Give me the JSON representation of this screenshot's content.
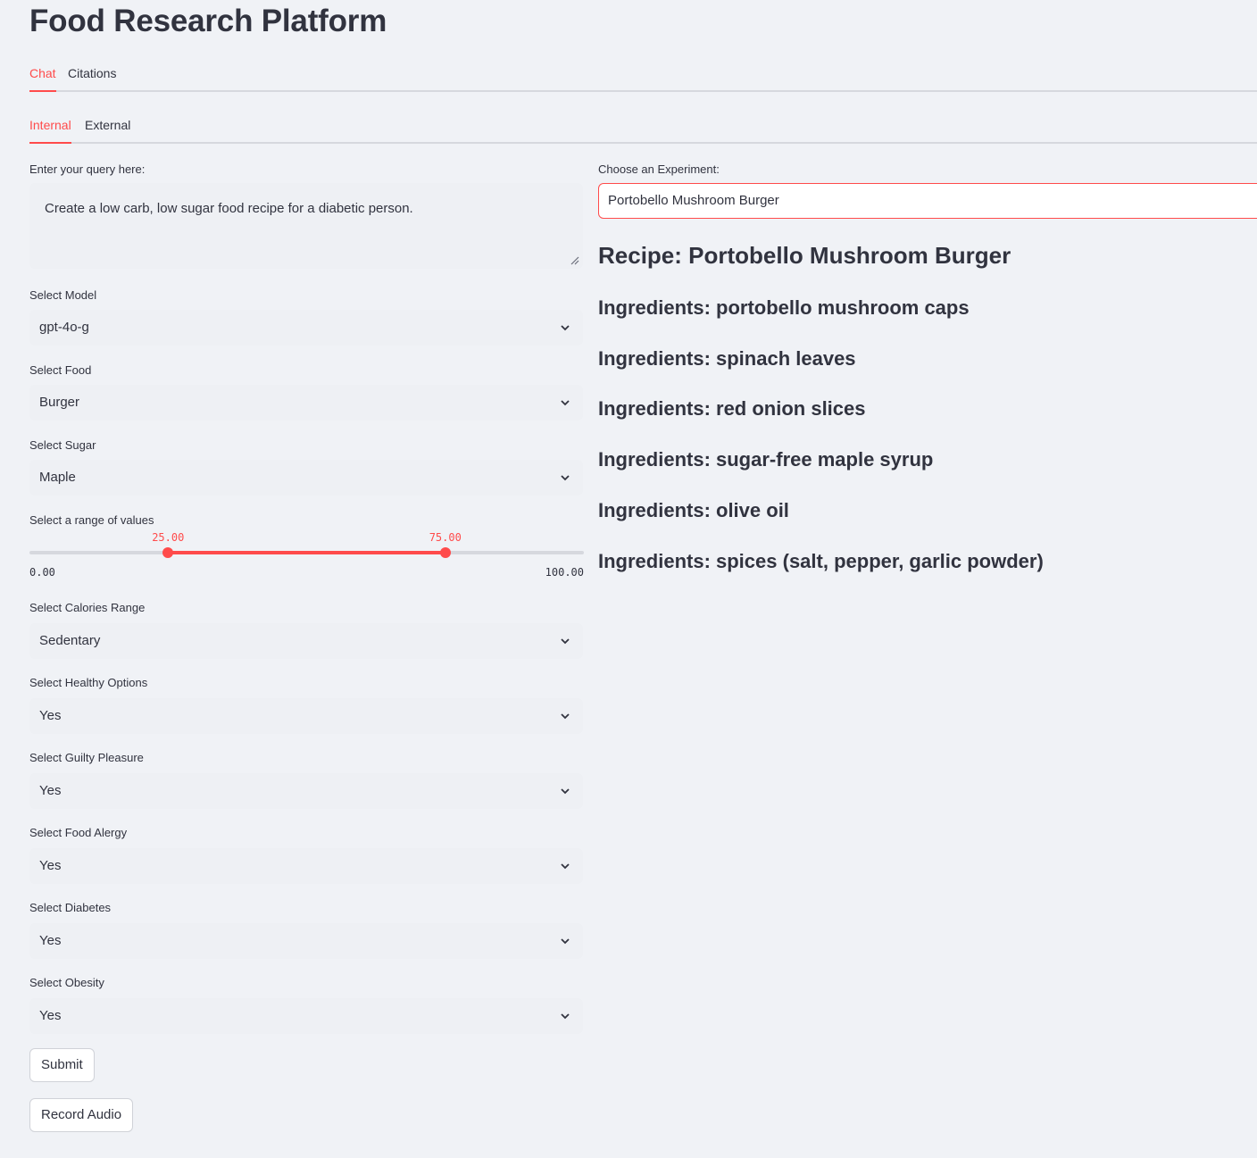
{
  "page": {
    "title": "Food Research Platform"
  },
  "tabs": {
    "main": [
      {
        "label": "Chat",
        "active": true
      },
      {
        "label": "Citations",
        "active": false
      }
    ],
    "sub": [
      {
        "label": "Internal",
        "active": true
      },
      {
        "label": "External",
        "active": false
      }
    ]
  },
  "query": {
    "label": "Enter your query here:",
    "value": "Create a low carb, low sugar food recipe for a diabetic person."
  },
  "selects": {
    "model": {
      "label": "Select Model",
      "value": "gpt-4o-g"
    },
    "food": {
      "label": "Select Food",
      "value": "Burger"
    },
    "sugar": {
      "label": "Select Sugar",
      "value": "Maple"
    },
    "calories": {
      "label": "Select Calories Range",
      "value": "Sedentary"
    },
    "healthy": {
      "label": "Select Healthy Options",
      "value": "Yes"
    },
    "guilty": {
      "label": "Select Guilty Pleasure",
      "value": "Yes"
    },
    "allergy": {
      "label": "Select Food Alergy",
      "value": "Yes"
    },
    "diabetes": {
      "label": "Select Diabetes",
      "value": "Yes"
    },
    "obesity": {
      "label": "Select Obesity",
      "value": "Yes"
    }
  },
  "range": {
    "label": "Select a range of values",
    "min": 0,
    "max": 100,
    "low": 25,
    "high": 75,
    "min_text": "0.00",
    "max_text": "100.00",
    "low_text": "25.00",
    "high_text": "75.00"
  },
  "buttons": {
    "submit": "Submit",
    "record": "Record Audio"
  },
  "experiment": {
    "label": "Choose an Experiment:",
    "value": "Portobello Mushroom Burger"
  },
  "recipe": {
    "title": "Recipe: Portobello Mushroom Burger",
    "ingredients": [
      "Ingredients: portobello mushroom caps",
      "Ingredients: spinach leaves",
      "Ingredients: red onion slices",
      "Ingredients: sugar-free maple syrup",
      "Ingredients: olive oil",
      "Ingredients: spices (salt, pepper, garlic powder)"
    ]
  },
  "colors": {
    "accent": "#ff4b4b",
    "background": "#f0f2f6",
    "text": "#31333f"
  },
  "icons": {
    "select_arrow": "chevron-down-icon",
    "textarea_resize": "resize-handle-icon"
  }
}
